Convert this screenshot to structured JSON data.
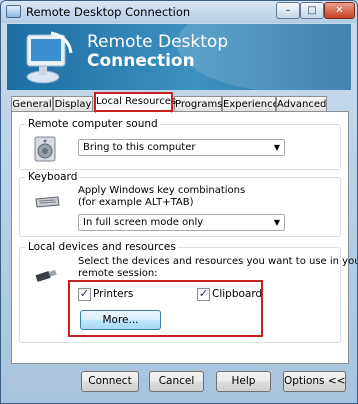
{
  "window": {
    "title": "Remote Desktop Connection",
    "min_label": "–",
    "max_label": "□",
    "close_label": "✕"
  },
  "banner": {
    "line1": "Remote Desktop",
    "line2": "Connection",
    "icon": "monitor-icon"
  },
  "tabs": [
    {
      "label": "General"
    },
    {
      "label": "Display"
    },
    {
      "label": "Local Resources",
      "active": true
    },
    {
      "label": "Programs"
    },
    {
      "label": "Experience"
    },
    {
      "label": "Advanced"
    }
  ],
  "sound": {
    "heading": "Remote computer sound",
    "selected": "Bring to this computer",
    "icon": "speaker-icon"
  },
  "keyboard": {
    "heading": "Keyboard",
    "line1": "Apply Windows key combinations",
    "line2": "(for example ALT+TAB)",
    "selected": "In full screen mode only",
    "icon": "keyboard-icon"
  },
  "devices": {
    "heading": "Local devices and resources",
    "line1": "Select the devices and resources you want to use in your",
    "line2": "remote session:",
    "printers_label": "Printers",
    "clipboard_label": "Clipboard",
    "printers_checked": true,
    "clipboard_checked": true,
    "more_label": "More...",
    "icon": "plug-icon"
  },
  "footer": {
    "connect": "Connect",
    "cancel": "Cancel",
    "help": "Help",
    "options": "Options <<"
  },
  "colors": {
    "highlight": "#c42121",
    "banner": "#2b7fb5"
  }
}
